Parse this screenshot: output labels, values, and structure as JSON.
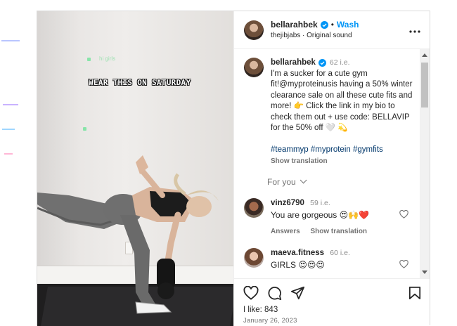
{
  "post": {
    "media": {
      "overlay_text": "WEAR THIS ON SATURDAY",
      "sparkle_text": "hi girls"
    },
    "header": {
      "username": "bellarahbek",
      "follow_label": "Wash",
      "separator": "•",
      "subtitle": "thejibjabs · Original sound",
      "more_icon": "more-horizontal-icon"
    },
    "caption": {
      "username": "bellarahbek",
      "time": "62 i.e.",
      "text": "I'm a sucker for a cute gym fit!@myproteinusis having a 50% winter clearance sale on all these cute fits and more! 👉 Click the link in my bio to check them out + use code: BELLAVIP for the 50% off 🤍 💫",
      "hashtags": "#teammyp #myprotein #gymfits",
      "show_translation": "Show translation"
    },
    "for_you": "For you",
    "comments": [
      {
        "username": "vinz6790",
        "time": "59 i.e.",
        "text": "You are gorgeous 😍🙌❤️",
        "answers": "Answers",
        "show_translation": "Show translation"
      },
      {
        "username": "maeva.fitness",
        "time": "60 i.e.",
        "text": "GIRLS 😍😍😍"
      }
    ],
    "footer": {
      "likes": "I like: 843",
      "date": "January 26, 2023"
    },
    "colors": {
      "link_blue": "#0095f6",
      "hashtag_blue": "#00376b",
      "muted": "#737373",
      "verified": "#0095f6"
    }
  }
}
